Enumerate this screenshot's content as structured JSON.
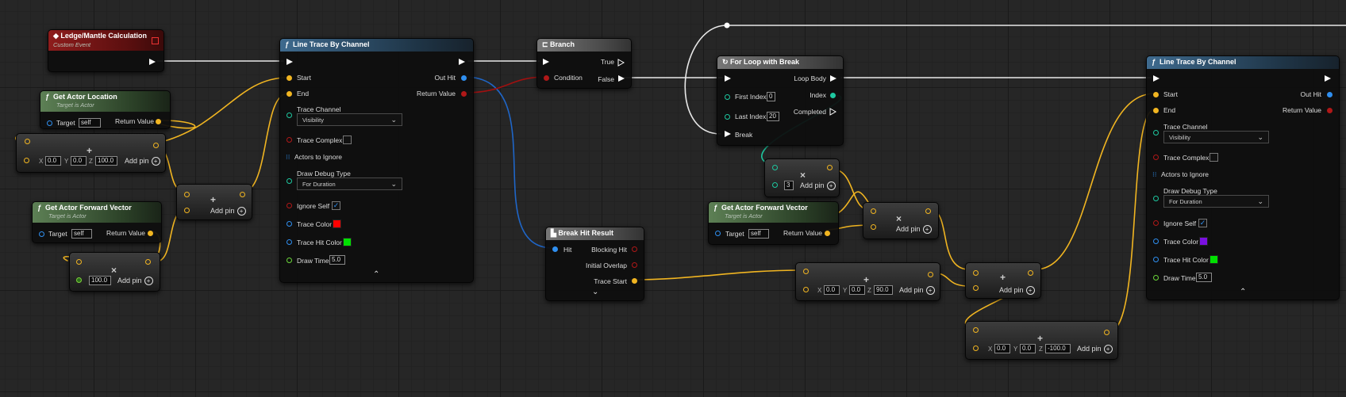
{
  "nodes": {
    "custom_event": {
      "title": "Ledge/Mantle Calculation",
      "subtitle": "Custom Event"
    },
    "get_actor_location": {
      "title": "Get Actor Location",
      "subtitle": "Target is Actor",
      "target_label": "Target",
      "target_value": "self",
      "return_label": "Return Value"
    },
    "make_vector_1": {
      "x_label": "X",
      "x": "0.0",
      "y_label": "Y",
      "y": "0.0",
      "z_label": "Z",
      "z": "100.0",
      "add_pin": "Add pin"
    },
    "add_node_1": {
      "add_pin": "Add pin"
    },
    "get_forward_vector_1": {
      "title": "Get Actor Forward Vector",
      "subtitle": "Target is Actor",
      "target_label": "Target",
      "target_value": "self",
      "return_label": "Return Value"
    },
    "multiply_1": {
      "value": "100.0",
      "add_pin": "Add pin"
    },
    "line_trace_1": {
      "title": "Line Trace By Channel",
      "start": "Start",
      "end": "End",
      "out_hit": "Out Hit",
      "return_value": "Return Value",
      "trace_channel_label": "Trace Channel",
      "trace_channel": "Visibility",
      "trace_complex": "Trace Complex",
      "actors_to_ignore": "Actors to Ignore",
      "draw_debug_type_label": "Draw Debug Type",
      "draw_debug_type": "For Duration",
      "ignore_self": "Ignore Self",
      "trace_color": "Trace Color",
      "trace_hit_color": "Trace Hit Color",
      "draw_time": "Draw Time",
      "draw_time_value": "5.0",
      "trace_color_hex": "#ff0000",
      "trace_hit_color_hex": "#00e000"
    },
    "branch": {
      "title": "Branch",
      "true_label": "True",
      "condition": "Condition",
      "false_label": "False"
    },
    "break_hit": {
      "title": "Break Hit Result",
      "hit": "Hit",
      "blocking_hit": "Blocking Hit",
      "initial_overlap": "Initial Overlap",
      "trace_start": "Trace Start"
    },
    "for_loop": {
      "title": "For Loop with Break",
      "loop_body": "Loop Body",
      "first_index": "First Index",
      "first_value": "0",
      "index": "Index",
      "last_index": "Last Index",
      "last_value": "20",
      "completed": "Completed",
      "break_label": "Break"
    },
    "multiply_int": {
      "value": "3",
      "add_pin": "Add pin"
    },
    "get_forward_vector_2": {
      "title": "Get Actor Forward Vector",
      "subtitle": "Target is Actor",
      "target_label": "Target",
      "target_value": "self",
      "return_label": "Return Value"
    },
    "multiply_2": {
      "add_pin": "Add pin"
    },
    "make_vector_2": {
      "x_label": "X",
      "x": "0.0",
      "y_label": "Y",
      "y": "0.0",
      "z_label": "Z",
      "z": "90.0",
      "add_pin": "Add pin"
    },
    "add_node_2": {
      "add_pin": "Add pin"
    },
    "make_vector_3": {
      "x_label": "X",
      "x": "0.0",
      "y_label": "Y",
      "y": "0.0",
      "z_label": "Z",
      "z": "-100.0",
      "add_pin": "Add pin"
    },
    "line_trace_2": {
      "title": "Line Trace By Channel",
      "start": "Start",
      "end": "End",
      "out_hit": "Out Hit",
      "return_value": "Return Value",
      "trace_channel_label": "Trace Channel",
      "trace_channel": "Visibility",
      "trace_complex": "Trace Complex",
      "actors_to_ignore": "Actors to Ignore",
      "draw_debug_type_label": "Draw Debug Type",
      "draw_debug_type": "For Duration",
      "ignore_self": "Ignore Self",
      "trace_color": "Trace Color",
      "trace_hit_color": "Trace Hit Color",
      "draw_time": "Draw Time",
      "draw_time_value": "5.0",
      "trace_color_hex": "#7a10e0",
      "trace_hit_color_hex": "#00e000"
    }
  },
  "colors": {
    "exec_wire": "#e8e8e8",
    "vector_wire": "#f1b521",
    "struct_wire": "#1f66c8",
    "bool_wire": "#a01010",
    "int_wire": "#1ec8a0"
  }
}
